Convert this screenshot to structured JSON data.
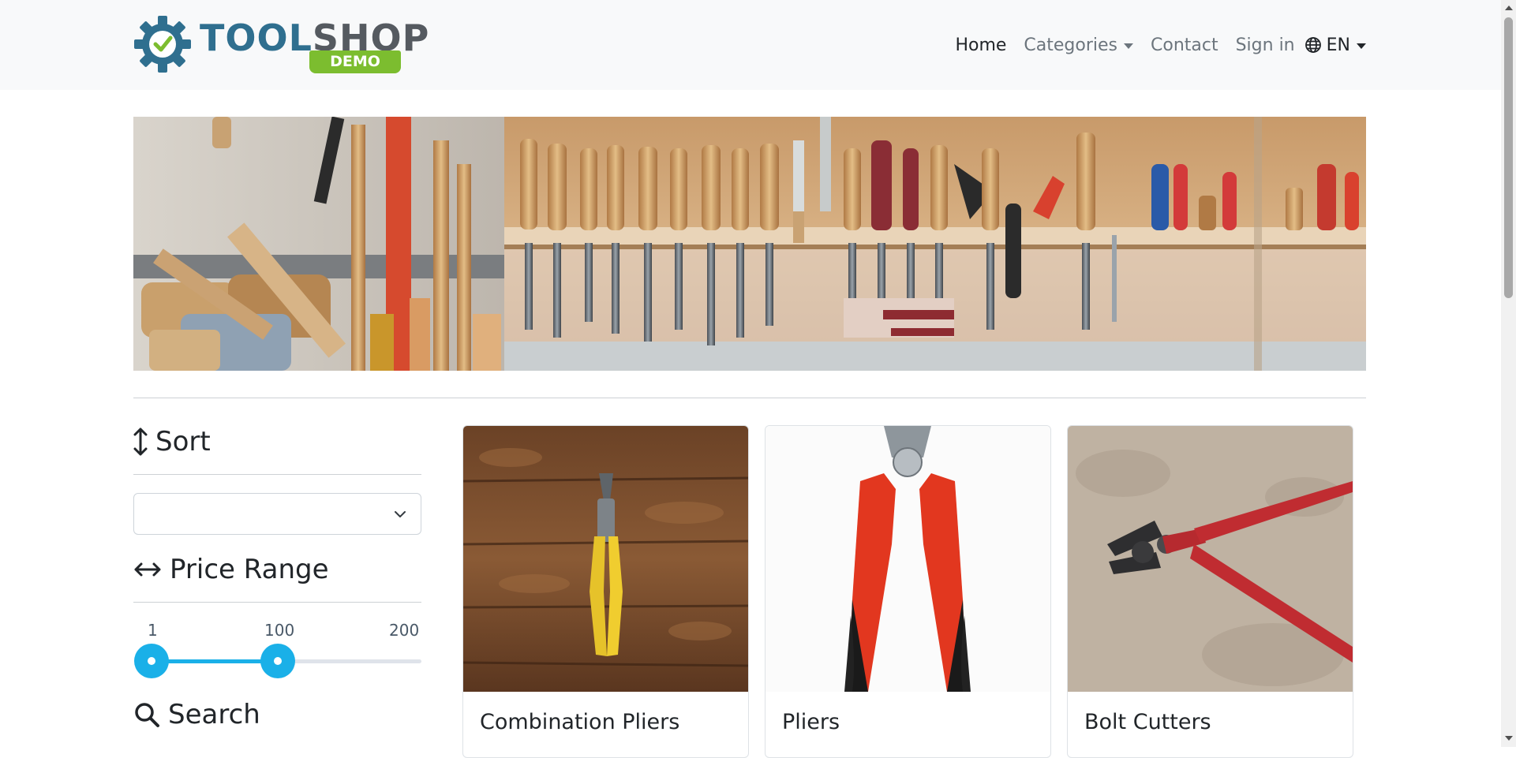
{
  "brand": {
    "name_part1": "TOOL",
    "name_part2": "SHOP",
    "badge": "DEMO",
    "colors": {
      "gear": "#2f6f8f",
      "check": "#7cbd2f",
      "badge": "#7cbd2f"
    }
  },
  "nav": {
    "items": [
      {
        "label": "Home",
        "active": true
      },
      {
        "label": "Categories",
        "dropdown": true
      },
      {
        "label": "Contact"
      },
      {
        "label": "Sign in"
      }
    ],
    "language": {
      "label": "EN",
      "icon": "globe-icon"
    }
  },
  "banner": {
    "subject": "workshop wall with chisels, hammers and hand tools"
  },
  "sidebar": {
    "sort": {
      "heading": "Sort",
      "icon": "arrows-vertical-icon",
      "selected": ""
    },
    "price_range": {
      "heading": "Price Range",
      "icon": "arrows-horizontal-icon",
      "min": "1",
      "max": "200",
      "low": "1",
      "high": "100",
      "accent": "#1ab0e8"
    },
    "search": {
      "heading": "Search",
      "icon": "search-icon"
    }
  },
  "products": [
    {
      "name": "Combination Pliers"
    },
    {
      "name": "Pliers"
    },
    {
      "name": "Bolt Cutters"
    }
  ]
}
